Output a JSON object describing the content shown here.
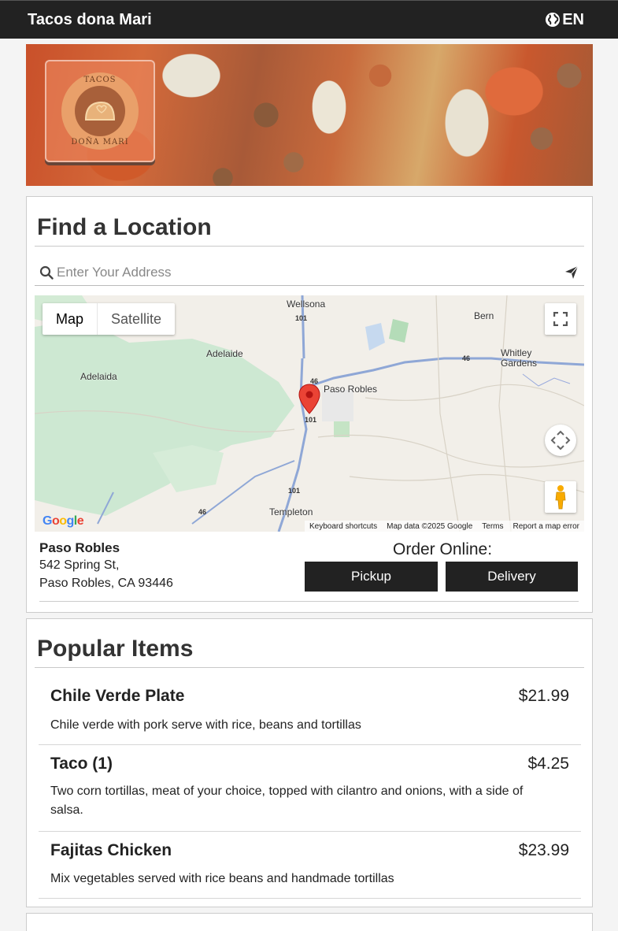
{
  "header": {
    "brand": "Tacos dona Mari",
    "language": "EN",
    "globe_icon": "globe-icon"
  },
  "hero": {
    "logo_top_text": "TACOS",
    "logo_bottom_text": "DOÑA MARI"
  },
  "locations": {
    "title": "Find a Location",
    "search": {
      "placeholder": "Enter Your Address",
      "value": ""
    },
    "map": {
      "type_buttons": [
        "Map",
        "Satellite"
      ],
      "active_type": "Map",
      "places": [
        "Wellsona",
        "Bern",
        "Adelaide",
        "Adelaida",
        "Paso Robles",
        "Whitley Gardens",
        "Templeton"
      ],
      "highway_shields": [
        "101",
        "46",
        "101",
        "46",
        "101",
        "46"
      ],
      "logo": "Google",
      "footer": {
        "shortcuts": "Keyboard shortcuts",
        "map_data": "Map data ©2025 Google",
        "terms": "Terms",
        "report": "Report a map error"
      }
    },
    "selected": {
      "name": "Paso Robles",
      "address_line1": "542 Spring St,",
      "address_line2": "Paso Robles, CA 93446"
    },
    "order": {
      "label": "Order Online:",
      "pickup": "Pickup",
      "delivery": "Delivery"
    }
  },
  "popular": {
    "title": "Popular Items",
    "items": [
      {
        "name": "Chile Verde Plate",
        "price": "$21.99",
        "description": "Chile verde with pork serve with rice, beans and tortillas"
      },
      {
        "name": "Taco (1)",
        "price": "$4.25",
        "description": "Two corn tortillas, meat of your choice, topped with cilantro and onions, with a side of salsa."
      },
      {
        "name": "Fajitas Chicken",
        "price": "$23.99",
        "description": "Mix vegetables served with rice beans and handmade tortillas"
      }
    ]
  },
  "colors": {
    "header_bg": "#222222",
    "button_bg": "#222222",
    "map_green": "#c8e6c9",
    "map_road": "#8fa7d6",
    "marker": "#ea4335"
  }
}
